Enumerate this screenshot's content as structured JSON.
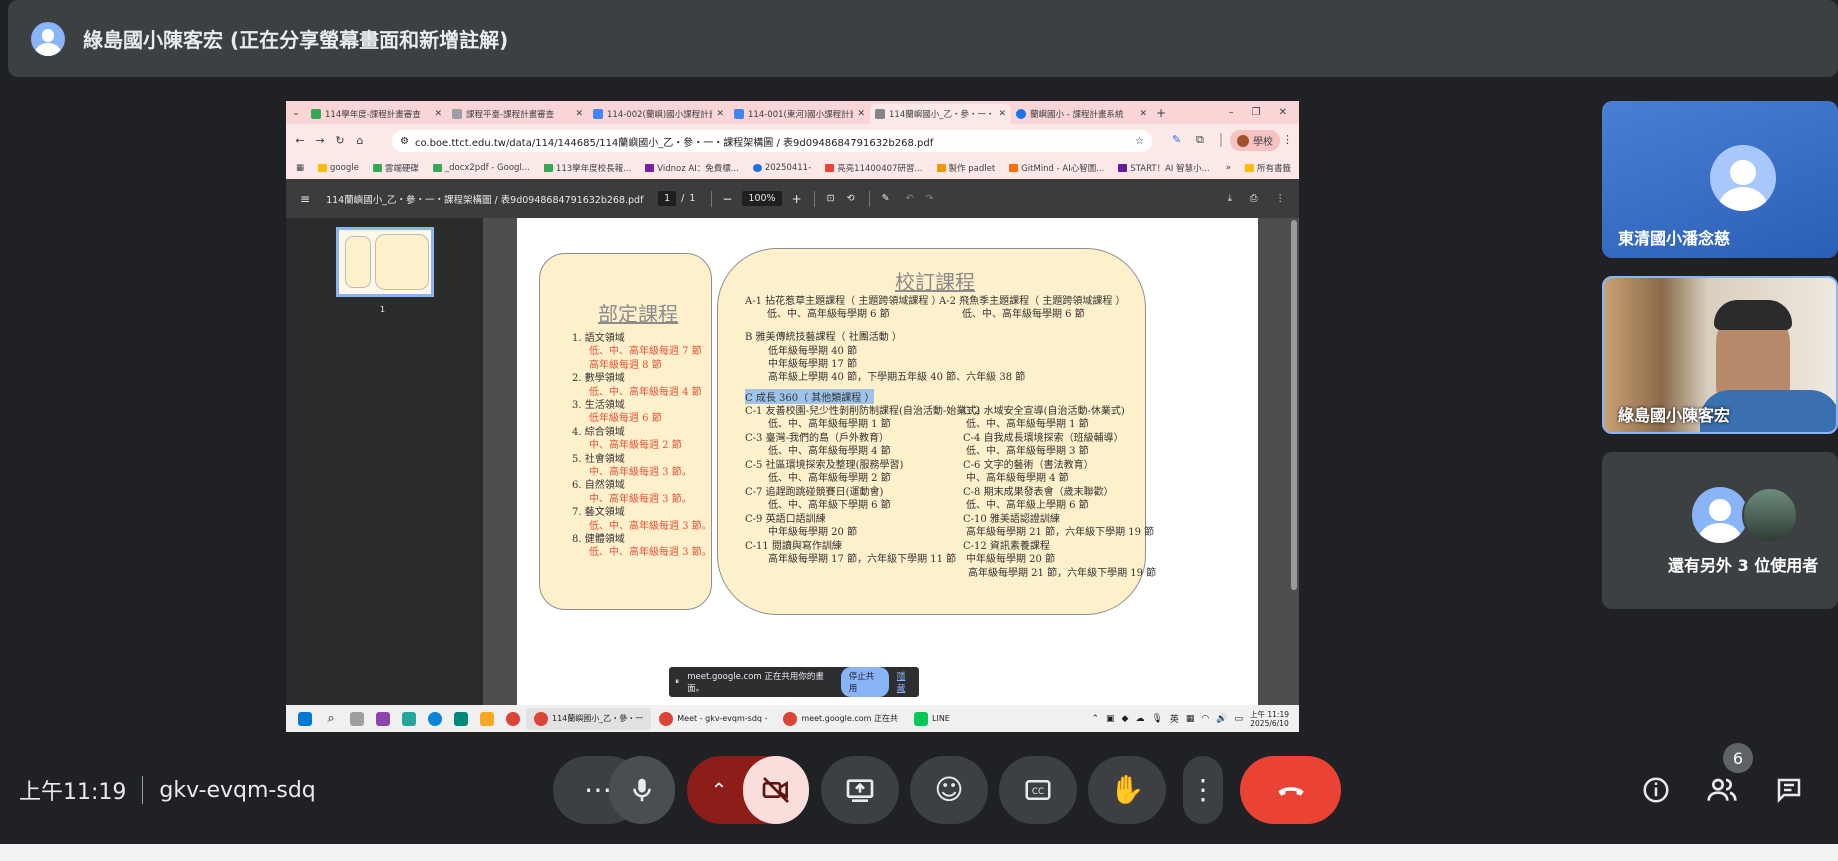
{
  "meeting": {
    "presenter_banner": "綠島國小陳客宏 (正在分享螢幕畫面和新增註解)",
    "time": "上午11:19",
    "code": "gkv-evqm-sdq",
    "participant_count": "6"
  },
  "browser": {
    "tabs": [
      {
        "label": "114學年度-課程計畫審查",
        "icon": "drive-icon"
      },
      {
        "label": "課程平臺-課程計畫審查",
        "icon": "site-icon"
      },
      {
        "label": "114-002(蘭嶼)國小課程計畫",
        "icon": "docs-icon"
      },
      {
        "label": "114-001(東河)國小課程計畫",
        "icon": "docs-icon"
      },
      {
        "label": "114蘭嶼國小_乙・參・一・",
        "icon": "pdf-icon"
      },
      {
        "label": "蘭嶼國小 - 課程計畫系統",
        "icon": "site-icon"
      }
    ],
    "url": "co.boe.ttct.edu.tw/data/114/144685/114蘭嶼國小_乙・參・一・課程架構圖 / 表9d0948684791632b268.pdf",
    "profile_label": "學校",
    "bookmarks": [
      "google",
      "雲端硬碟",
      "_docx2pdf - Googl...",
      "113學年度校長報...",
      "Vidnoz AI：免費標...",
      "20250411-",
      "亮亮11400407研習...",
      "製作 padlet",
      "GitMind - AI心智圖...",
      "START！AI 智慧小..."
    ],
    "bookmarks_all": "所有書籤"
  },
  "pdf": {
    "filename": "114蘭嶼國小_乙・參・一・課程架構圖 / 表9d0948684791632b268.pdf",
    "page_current": "1",
    "page_sep": "/",
    "page_total": "1",
    "zoom": "100%",
    "thumb_num": "1"
  },
  "doc": {
    "left": {
      "title": "部定課程",
      "lines": [
        {
          "text": "1.  語文領域",
          "red": false
        },
        {
          "text": "低、中、高年級每週 7 節",
          "red": true
        },
        {
          "text": "高年級每週 8 節",
          "red": true
        },
        {
          "text": "2.  數學領域",
          "red": false
        },
        {
          "text": "低、中、高年級每週 4 節",
          "red": true
        },
        {
          "text": "3.  生活領域",
          "red": false
        },
        {
          "text": "低年級每週 6 節",
          "red": true
        },
        {
          "text": "4.  綜合領域",
          "red": false
        },
        {
          "text": "中、高年級每週 2 節",
          "red": true
        },
        {
          "text": "5.  社會領域",
          "red": false
        },
        {
          "text": "中、高年級每週 3 節。",
          "red": true
        },
        {
          "text": "6.  自然領域",
          "red": false
        },
        {
          "text": "中、高年級每週 3 節。",
          "red": true
        },
        {
          "text": "7.  藝文領域",
          "red": false
        },
        {
          "text": "低、中、高年級每週 3 節。",
          "red": true
        },
        {
          "text": "8.  健體領域",
          "red": false
        },
        {
          "text": "低、中、高年級每週 3 節。",
          "red": true
        }
      ]
    },
    "right": {
      "title": "校訂課程",
      "a1": "A-1  拈花惹草主題課程（ 主題跨領域課程 ）",
      "a1_sub": "低、中、高年級每學期 6 節",
      "a2": "A-2  飛魚季主題課程（ 主題跨領域課程 ）",
      "a2_sub": "低、中、高年級每學期 6 節",
      "b": "B  雅美傳統技藝課程（ 社團活動 ）",
      "b_sub": [
        "低年級每學期 40 節",
        "中年級每學期 17 節",
        "高年級上學期 40 節，下學期五年級 40 節、六年級 38 節"
      ],
      "c_head": "C  成長 360（ 其他類課程 ）",
      "c_left": [
        {
          "t": "C-1  友善校園-兒少性剝削防制課程(自治活動-始業式)",
          "s": "低、中、高年級每學期 1 節"
        },
        {
          "t": "C-3  臺灣-我們的島（戶外教育）",
          "s": "低、中、高年級每學期 4 節"
        },
        {
          "t": "C-5  社區環境探索及整理(服務學習)",
          "s": "低、中、高年級每學期 2 節"
        },
        {
          "t": "C-7  追趕跑跳碰競賽日(運動會)",
          "s": "低、中、高年級下學期 6 節"
        },
        {
          "t": "C-9  英語口語訓練",
          "s": "中年級每學期 20 節"
        },
        {
          "t": "C-11  閱讀與寫作訓練",
          "s": "高年級每學期 17 節，六年級下學期 11 節"
        }
      ],
      "c_right": [
        {
          "t": "C-2  水域安全宣導(自治活動-休業式)",
          "s": "低、中、高年級每學期 1 節"
        },
        {
          "t": "C-4  自我成長環境探索（班級輔導）",
          "s": "低、中、高年級每學期 3 節"
        },
        {
          "t": "C-6   文字的藝術（書法教育）",
          "s": "中、高年級每學期 4 節"
        },
        {
          "t": "C-8   期末成果發表會（歲末聯歡）",
          "s": "低、中、高年級上學期 6 節"
        },
        {
          "t": "C-10  雅美語認證訓練",
          "s": "高年級每學期 21 節，六年級下學期 19 節"
        },
        {
          "t": "C-12  資訊素養課程",
          "s": "中年級每學期 20 節",
          "s2": "高年級每學期 21 節，六年級下學期 19 節"
        }
      ]
    }
  },
  "share_notice": {
    "text": "meet.google.com 正在共用你的畫面。",
    "stop": "停止共用",
    "hide": "隱藏"
  },
  "taskbar": {
    "apps": [
      "114蘭嶼國小_乙・參・一",
      "Meet - gkv-evqm-sdq -",
      "meet.google.com 正在共",
      "LINE"
    ],
    "ime": "英",
    "time": "上午 11:19",
    "date": "2025/6/10"
  },
  "tiles": {
    "t1": "東清國小潘念慈",
    "t2": "綠島國小陳客宏",
    "t3": "還有另外 3 位使用者"
  },
  "colors": {
    "end_call": "#ea4335",
    "camera_off_bg": "#f9dedc",
    "camera_group": "#8c1d18",
    "tile": "#3c4043",
    "accent": "#8ab4f8"
  }
}
